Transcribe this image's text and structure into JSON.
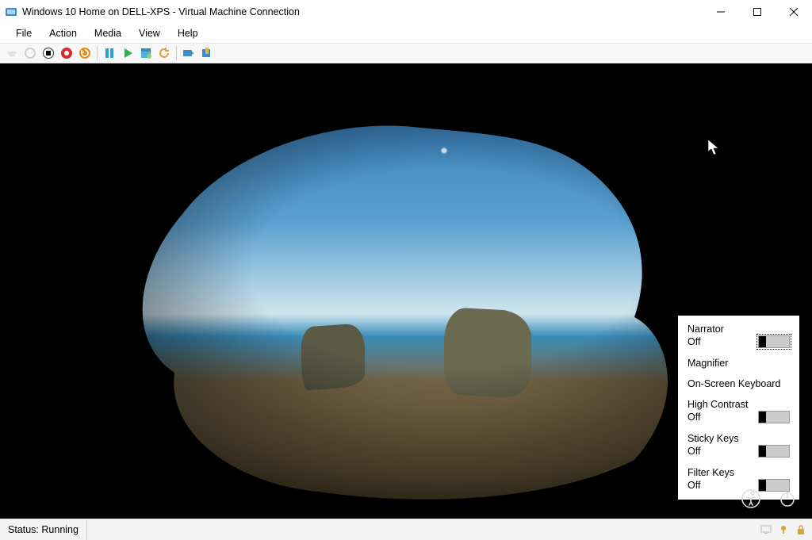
{
  "window": {
    "title": "Windows 10 Home on DELL-XPS - Virtual Machine Connection"
  },
  "menu": {
    "items": [
      "File",
      "Action",
      "Media",
      "View",
      "Help"
    ]
  },
  "toolbar": {
    "icons": [
      "ctrl-alt-del",
      "power",
      "stop",
      "shutdown",
      "reset",
      "pause",
      "start",
      "checkpoint",
      "revert",
      "share",
      "enhanced"
    ]
  },
  "accessibility": {
    "items": [
      {
        "label": "Narrator",
        "state": "Off",
        "toggle": true,
        "focused": true
      },
      {
        "label": "Magnifier",
        "state": null,
        "toggle": false
      },
      {
        "label": "On-Screen Keyboard",
        "state": null,
        "toggle": false
      },
      {
        "label": "High Contrast",
        "state": "Off",
        "toggle": true
      },
      {
        "label": "Sticky Keys",
        "state": "Off",
        "toggle": true
      },
      {
        "label": "Filter Keys",
        "state": "Off",
        "toggle": true
      }
    ]
  },
  "lockscreen": {
    "ease_icon": "ease-of-access-icon",
    "power_icon": "power-icon"
  },
  "status": {
    "text": "Status: Running"
  }
}
